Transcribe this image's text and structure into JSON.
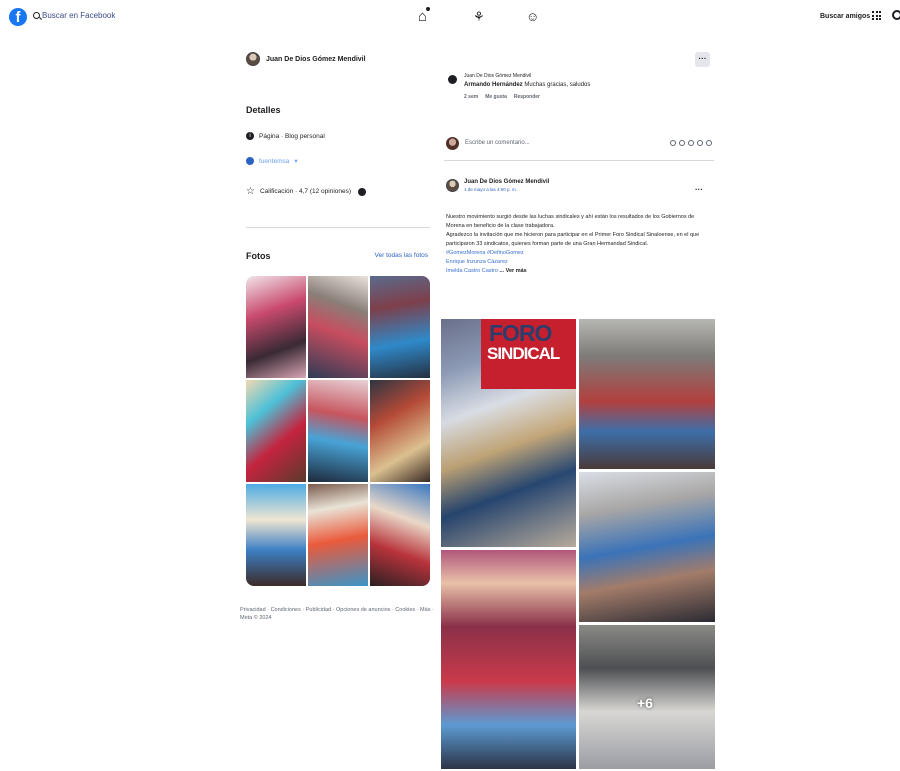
{
  "topbar": {
    "search_placeholder": "Buscar en Facebook",
    "find_friends": "Buscar amigos"
  },
  "profile": {
    "name": "Juan De Dios Gómez Mendivil"
  },
  "details": {
    "title": "Detalles",
    "page_type": "Página · Blog personal",
    "link": "fuentemsa",
    "rating": "Calificación · 4,7 (12 opiniones)"
  },
  "photos": {
    "title": "Fotos",
    "see_all": "Ver todas las fotos"
  },
  "footer": {
    "links": "Privacidad · Condiciones · Publicidad · Opciones de anuncios · Cookies · Más · Meta © 2024"
  },
  "comment_preview": {
    "author": "Juan De Dios Gómez Mendivil",
    "commenter": "Armando Hernández",
    "text": "Muchas gracias, saludos",
    "time": "2 sem",
    "like": "Me gusta",
    "reply": "Responder"
  },
  "write_comment": {
    "placeholder": "Escribe un comentario..."
  },
  "post": {
    "author": "Juan De Dios Gómez Mendivil",
    "date": "1 de mayo a las 4:00 p. m.",
    "text_line1": "Nuestro movimiento surgió desde las luchas sindicales y ahí están los resultados de los Gobiernos de Morena en beneficio de la clase trabajadora.",
    "text_line2": "Agradezco la invitación que me hicieron para participar en el Primer Foro Sindical Sinaloense, en el que participaron 33 sindicatos, quienes forman parte de una Gran Hermandad Sindical.",
    "hashtags": "#GomezMorena #DefinoGomez",
    "tag1": "Enrique Inzunza Cázarez",
    "tag2": "Imelda Castro Castro",
    "see_more": "... Ver más",
    "banner_word1": "FORO",
    "banner_word2": "SINDICAL",
    "more_photos": "+6"
  },
  "icons": {
    "logo": "facebook-logo",
    "home": "home-icon",
    "friends": "friends-icon",
    "groups": "groups-icon",
    "apps": "apps-grid-icon",
    "messenger": "messenger-icon"
  },
  "colors": {
    "brand": "#1877f2",
    "link": "#2d62c5",
    "text": "#1c1e21",
    "muted": "#606770"
  }
}
